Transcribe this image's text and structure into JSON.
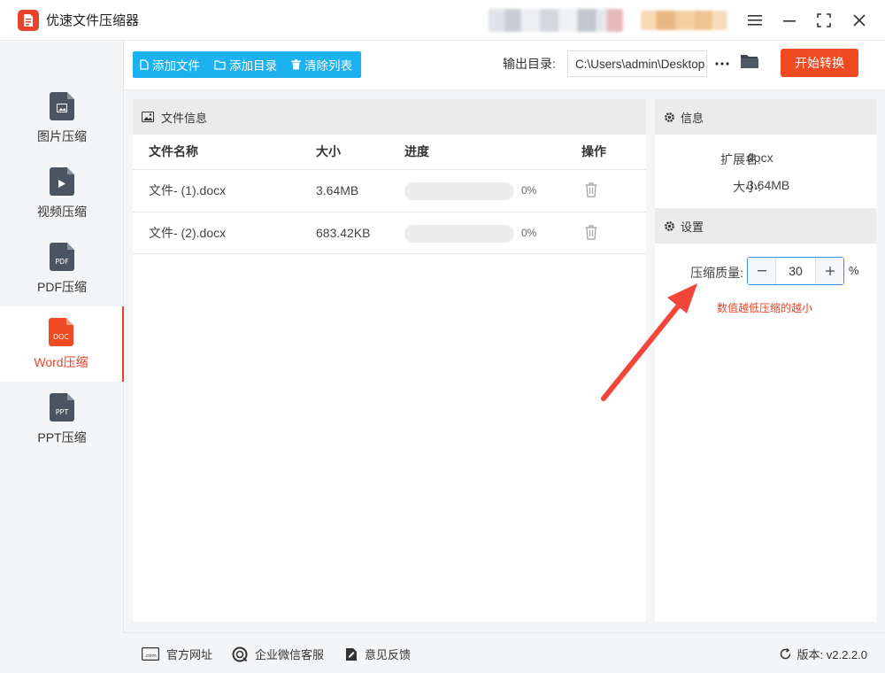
{
  "app": {
    "title": "优速文件压缩器"
  },
  "sidebar": {
    "items": [
      {
        "label": "图片压缩",
        "icon": "image-file-icon",
        "tag": ""
      },
      {
        "label": "视频压缩",
        "icon": "video-file-icon",
        "tag": ""
      },
      {
        "label": "PDF压缩",
        "icon": "pdf-file-icon",
        "tag": "PDF"
      },
      {
        "label": "Word压缩",
        "icon": "doc-file-icon",
        "tag": "DOC",
        "active": true
      },
      {
        "label": "PPT压缩",
        "icon": "ppt-file-icon",
        "tag": "PPT"
      }
    ]
  },
  "toolbar": {
    "add_file": "添加文件",
    "add_dir": "添加目录",
    "clear_list": "清除列表",
    "output_label": "输出目录:",
    "output_path": "C:\\Users\\admin\\Desktop",
    "start": "开始转换"
  },
  "file_panel": {
    "title": "文件信息",
    "columns": {
      "name": "文件名称",
      "size": "大小",
      "progress": "进度",
      "action": "操作"
    },
    "rows": [
      {
        "name": "文件- (1).docx",
        "size": "3.64MB",
        "progress": 0,
        "progress_text": "0%"
      },
      {
        "name": "文件- (2).docx",
        "size": "683.42KB",
        "progress": 0,
        "progress_text": "0%"
      }
    ]
  },
  "info_panel": {
    "title": "信息",
    "ext_label": "扩展名:",
    "ext_value": "docx",
    "size_label": "大小:",
    "size_value": "3.64MB"
  },
  "settings_panel": {
    "title": "设置",
    "quality_label": "压缩质量:",
    "quality_value": "30",
    "percent": "%",
    "hint": "数值越低压缩的越小"
  },
  "footer": {
    "website": "官方网址",
    "wechat": "企业微信客服",
    "feedback": "意见反馈",
    "version": "版本: v2.2.2.0"
  },
  "colors": {
    "accent": "#f04a23",
    "primary": "#1cb1ef"
  }
}
